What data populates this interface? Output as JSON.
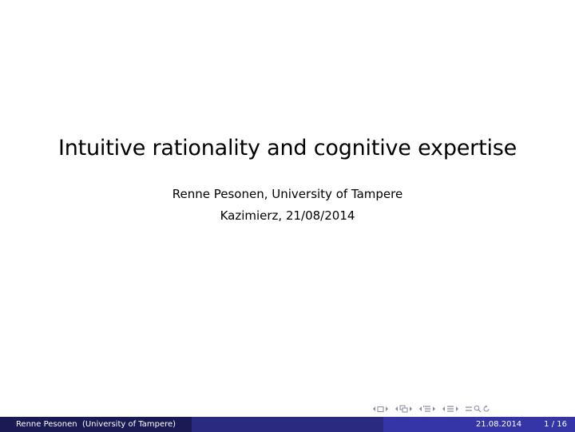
{
  "slide": {
    "title": "Intuitive rationality and cognitive expertise",
    "author": "Renne Pesonen, University of Tampere",
    "event": "Kazimierz, 21/08/2014"
  },
  "footer": {
    "author_short": "Renne Pesonen",
    "institute_short": "(University of Tampere)",
    "date": "21.08.2014",
    "page": "1 / 16"
  },
  "nav": {
    "icons": [
      "frame-prev-icon",
      "frame-icon",
      "frame-next-icon",
      "subsection-prev-icon",
      "subsection-icon",
      "subsection-next-icon",
      "section-prev-icon",
      "section-icon",
      "section-next-icon",
      "doc-prev-icon",
      "doc-icon",
      "doc-next-icon",
      "align-icon",
      "search-icon",
      "back-icon"
    ],
    "color": "#8a8aa0"
  },
  "colors": {
    "footer_left": "#1a1a54",
    "footer_mid": "#2a2a80",
    "footer_right": "#3535a8"
  }
}
